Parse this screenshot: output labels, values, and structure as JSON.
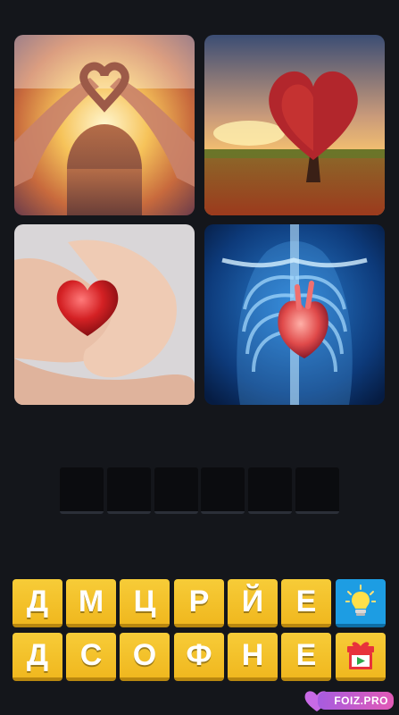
{
  "images": [
    {
      "icon": "heart-hands-sunset-photo"
    },
    {
      "icon": "heart-shaped-tree-photo"
    },
    {
      "icon": "red-heart-in-hands-photo"
    },
    {
      "icon": "anatomical-heart-xray-photo"
    }
  ],
  "answer": {
    "slot_count": 6
  },
  "keyboard": {
    "row1": [
      "Д",
      "М",
      "Ц",
      "Р",
      "Й",
      "Е"
    ],
    "row2": [
      "Д",
      "С",
      "О",
      "Ф",
      "Н",
      "Е"
    ]
  },
  "helpers": {
    "hint_icon": "lightbulb-icon",
    "video_icon": "gift-video-icon"
  },
  "watermark": {
    "text": "FOIZ.PRO"
  },
  "colors": {
    "background": "#14161b",
    "key": "#f0b81f",
    "hint": "#1d9de3"
  }
}
